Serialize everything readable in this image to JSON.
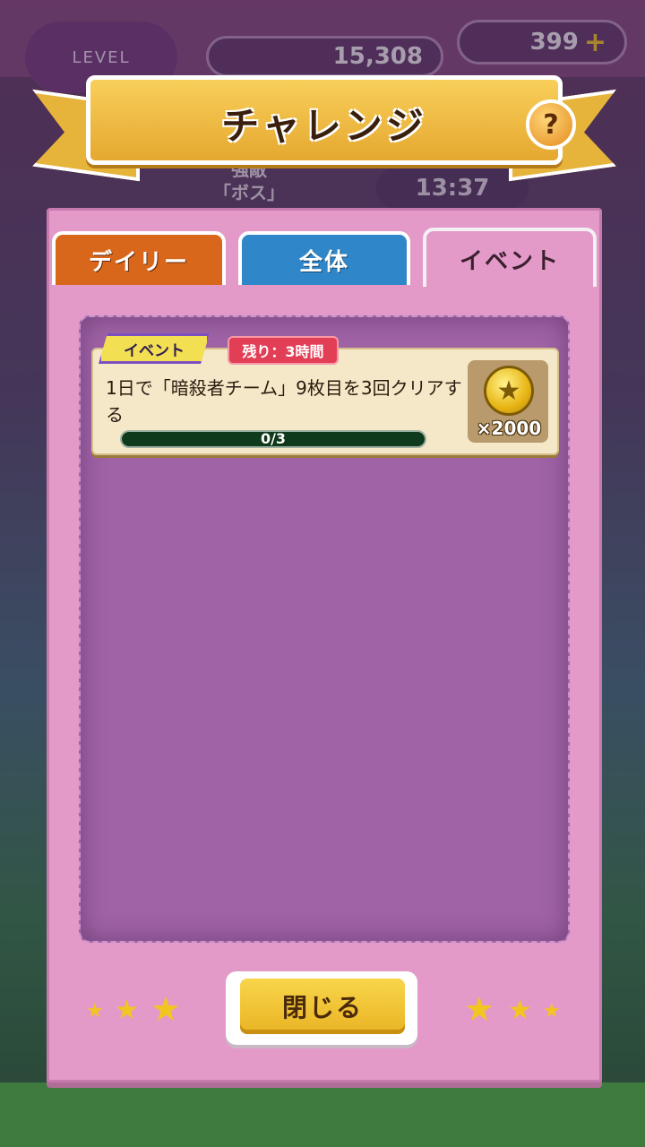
{
  "background": {
    "level_text": "LEVEL",
    "coins": "15,308",
    "gems": "399",
    "gems_plus": "+",
    "boss_label": "強敵\n「ボス」",
    "timer": "13:37"
  },
  "banner": {
    "title": "チャレンジ",
    "help": "?"
  },
  "tabs": [
    {
      "label": "デイリー",
      "active": false
    },
    {
      "label": "全体",
      "active": false
    },
    {
      "label": "イベント",
      "active": true
    }
  ],
  "challenges": [
    {
      "tag": "イベント",
      "remaining": "残り：3時間",
      "description": "1日で「暗殺者チーム」9枚目を3回クリアする",
      "progress_text": "0/3",
      "progress_fraction": 0.0,
      "reward_count": "×2000",
      "reward_icon": "star-coin-icon"
    }
  ],
  "footer": {
    "close_label": "閉じる"
  },
  "colors": {
    "panel": "#e39ac8",
    "felt": "#a064a6",
    "tab_daily": "#d8671c",
    "tab_all": "#2f86c9",
    "banner": "#e7b43b",
    "button": "#f0c433"
  }
}
